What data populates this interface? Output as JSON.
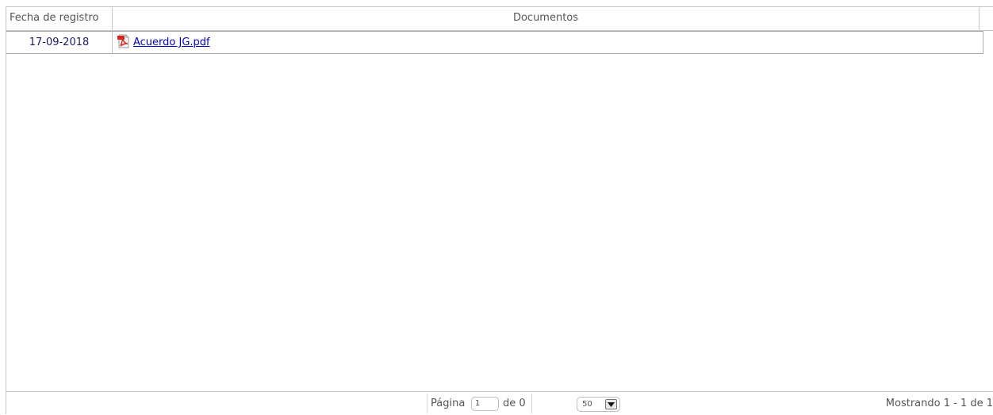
{
  "grid": {
    "columns": {
      "fecha": "Fecha de registro",
      "documentos": "Documentos"
    },
    "rows": [
      {
        "fecha": "17-09-2018",
        "documento": "Acuerdo JG.pdf",
        "icon": "pdf-icon"
      }
    ]
  },
  "pager": {
    "page_label": "Página",
    "page_value": "1",
    "of_label": "de 0",
    "page_size": "50",
    "info": "Mostrando 1 - 1 de 1"
  },
  "colors": {
    "border": "#c5c5c5",
    "link": "#0000cc",
    "date_text": "#1a1a6e",
    "pdf_red": "#d9251c"
  }
}
